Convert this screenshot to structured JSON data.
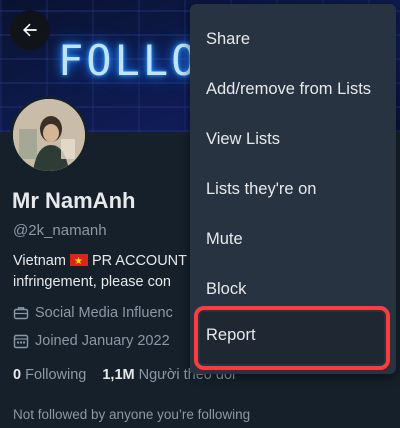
{
  "banner": {
    "neon_text": "FOLLO"
  },
  "profile": {
    "name": "Mr NamAnh",
    "handle": "@2k_namanh",
    "bio_line1_a": "Vietnam",
    "bio_line1_b": "PR ACCOUNT",
    "bio_line2": "infringement, please con",
    "work": "Social Media Influenc",
    "joined": "Joined January 2022",
    "following_count": "0",
    "following_label": "Following",
    "followers_count": "1,1M",
    "followers_label": "Người theo dõi",
    "not_followed": "Not followed by anyone you’re following"
  },
  "menu": {
    "items": [
      "Share",
      "Add/remove from Lists",
      "View Lists",
      "Lists they're on",
      "Mute",
      "Block",
      "Report"
    ]
  },
  "colors": {
    "background": "#15202b",
    "menu": "#273340",
    "highlight": "#ff3b3b",
    "muted_text": "#8b98a5"
  }
}
